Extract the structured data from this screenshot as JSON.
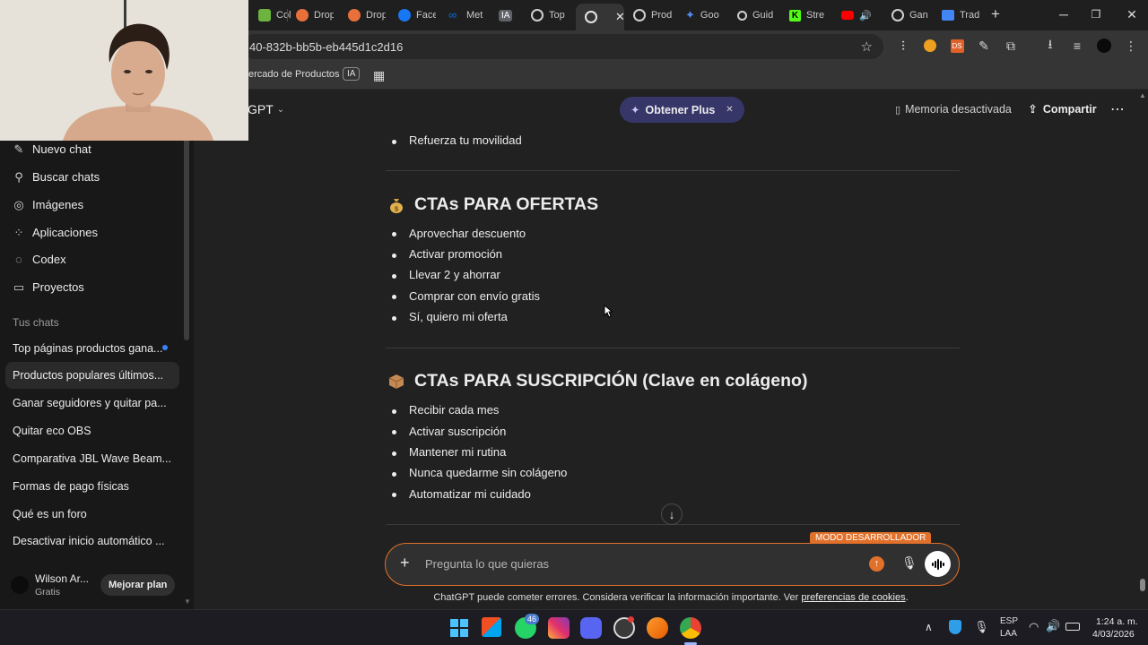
{
  "browser": {
    "tabs": [
      {
        "label": "Col",
        "color": "#6db33f"
      },
      {
        "label": "Drop",
        "color": "#e8703a"
      },
      {
        "label": "Drop",
        "color": "#e8703a"
      },
      {
        "label": "Face",
        "color": "#1877f2"
      },
      {
        "label": "Met",
        "color": "#0668e1"
      },
      {
        "label": "IA",
        "color": "#5f6368"
      },
      {
        "label": "Top",
        "color": "#cfcfcf"
      },
      {
        "label": "",
        "color": "#cfcfcf",
        "active": true
      },
      {
        "label": "Prod",
        "color": "#cfcfcf"
      },
      {
        "label": "Goo",
        "color": "#4f8cf5"
      },
      {
        "label": "Guid",
        "color": "#cfcfcf"
      },
      {
        "label": "Stre",
        "color": "#53fc18"
      },
      {
        "label": "",
        "color": "#ff0000"
      },
      {
        "label": "Gan",
        "color": "#cfcfcf"
      },
      {
        "label": "Trad",
        "color": "#4285f4"
      }
    ],
    "url": "40-832b-bb5b-eb445d1c2d16",
    "bookmark_label": "ercado de Productos",
    "bookmark_badge": "IA"
  },
  "sidebar": {
    "nav": [
      {
        "label": "Nuevo chat",
        "icon": "edit-icon"
      },
      {
        "label": "Buscar chats",
        "icon": "search-icon"
      },
      {
        "label": "Imágenes",
        "icon": "images-icon"
      },
      {
        "label": "Aplicaciones",
        "icon": "apps-icon"
      },
      {
        "label": "Codex",
        "icon": "codex-icon"
      },
      {
        "label": "Proyectos",
        "icon": "folder-icon"
      }
    ],
    "section_title": "Tus chats",
    "chats": [
      "Top páginas productos gana...",
      "Productos populares últimos...",
      "Ganar seguidores y quitar pa...",
      "Quitar eco OBS",
      "Comparativa JBL Wave Beam...",
      "Formas de pago físicas",
      "Qué es un foro",
      "Desactivar inicio automático ..."
    ],
    "user_name": "Wilson Ar...",
    "user_plan": "Gratis",
    "upgrade_label": "Mejorar plan"
  },
  "header": {
    "model": "GPT",
    "plus_label": "Obtener Plus",
    "memory_label": "Memoria desactivada",
    "share_label": "Compartir"
  },
  "content": {
    "prev_item": "Refuerza tu movilidad",
    "sections": [
      {
        "title": "CTAs PARA OFERTAS",
        "emoji": "money-bag-icon",
        "items": [
          "Aprovechar descuento",
          "Activar promoción",
          "Llevar 2 y ahorrar",
          "Comprar con envío gratis",
          "Sí, quiero mi oferta"
        ]
      },
      {
        "title": "CTAs PARA SUSCRIPCIÓN (Clave en colágeno)",
        "emoji": "package-icon",
        "items": [
          "Recibir cada mes",
          "Activar suscripción",
          "Mantener mi rutina",
          "Nunca quedarme sin colágeno",
          "Automatizar mi cuidado"
        ]
      }
    ]
  },
  "composer": {
    "placeholder": "Pregunta lo que quieras",
    "dev_badge": "MODO DESARROLLADOR",
    "disclaimer": "ChatGPT puede cometer errores. Considera verificar la información importante. Ver",
    "disclaimer_link": "preferencias de cookies",
    "disclaimer_end": "."
  },
  "taskbar": {
    "whatsapp_badge": "46",
    "lang": "ESP",
    "lang2": "LAA",
    "time": "1:24 a. m.",
    "date": "4/03/2026"
  }
}
